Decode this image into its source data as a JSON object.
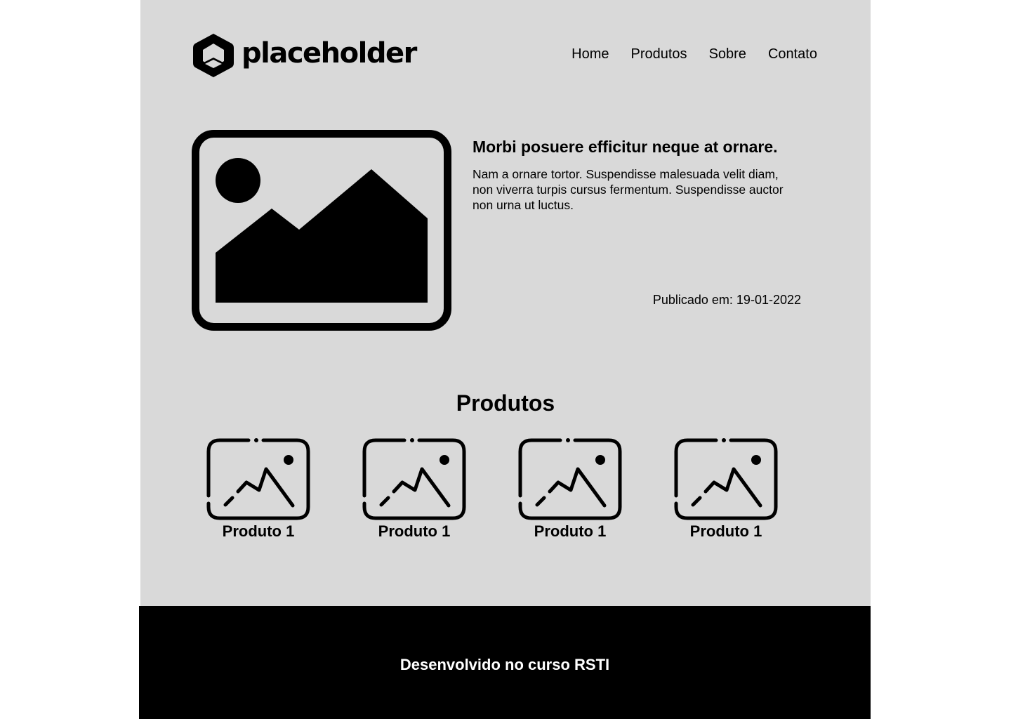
{
  "header": {
    "logo_text": "placeholder",
    "nav": [
      {
        "label": "Home"
      },
      {
        "label": "Produtos"
      },
      {
        "label": "Sobre"
      },
      {
        "label": "Contato"
      }
    ]
  },
  "hero": {
    "image_icon": "image-placeholder-icon",
    "title": "Morbi posuere efficitur neque at ornare.",
    "text": "Nam a ornare tortor. Suspendisse malesuada velit diam, non viverra turpis cursus fermentum. Suspendisse auctor non urna ut luctus.",
    "date": "Publicado em: 19-01-2022"
  },
  "products": {
    "heading": "Produtos",
    "items": [
      {
        "name": "Produto 1",
        "icon": "image-icon"
      },
      {
        "name": "Produto 1",
        "icon": "image-icon"
      },
      {
        "name": "Produto 1",
        "icon": "image-icon"
      },
      {
        "name": "Produto 1",
        "icon": "image-icon"
      }
    ]
  },
  "footer": {
    "text": "Desenvolvido no curso RSTI"
  },
  "colors": {
    "main_background": "#d9d9d9",
    "footer_background": "#000000",
    "text": "#000000",
    "footer_text": "#ffffff"
  }
}
